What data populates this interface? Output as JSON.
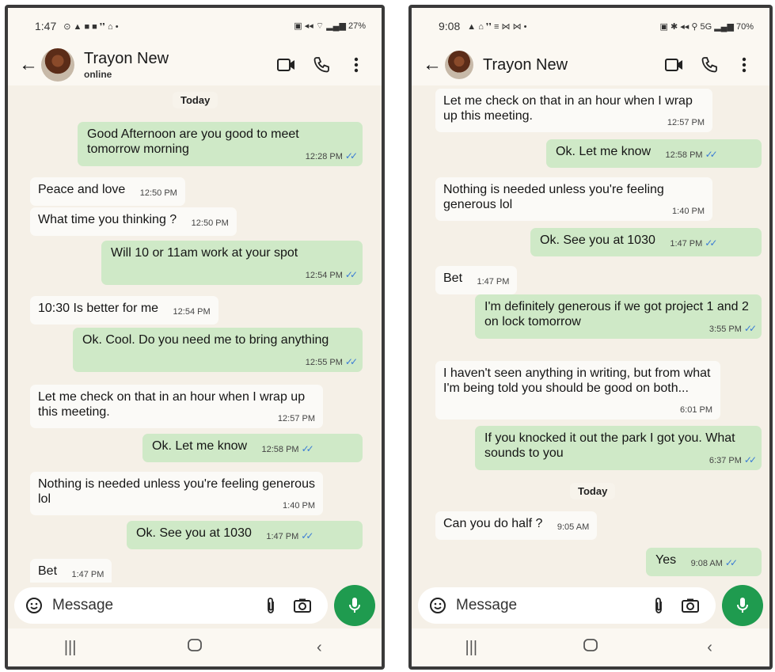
{
  "left": {
    "status_bar": {
      "time": "1:47",
      "left_icons": "⊙ ▲ ■ ■ ❜❜ ⌂ •",
      "right_icons": "▣ ◂◂ ⌔ ▂▄▆ 27%"
    },
    "header": {
      "contact_name": "Trayon New",
      "contact_status": "online"
    },
    "day_label": "Today",
    "messages": [
      {
        "text": "Good Afternoon are you good to meet tomorrow morning",
        "time": "12:28 PM",
        "dir": "out"
      },
      {
        "text": "Peace and love",
        "time": "12:50 PM",
        "dir": "in"
      },
      {
        "text": "What time you thinking ?",
        "time": "12:50 PM",
        "dir": "in"
      },
      {
        "text": "Will 10 or 11am work at your spot",
        "time": "12:54 PM",
        "dir": "out"
      },
      {
        "text": "10:30 Is better for me",
        "time": "12:54 PM",
        "dir": "in"
      },
      {
        "text": "Ok. Cool.  Do you need me to bring anything",
        "time": "12:55 PM",
        "dir": "out"
      },
      {
        "text": "Let me check on that in an hour when I wrap up this meeting.",
        "time": "12:57 PM",
        "dir": "in"
      },
      {
        "text": "Ok. Let me know",
        "time": "12:58 PM",
        "dir": "out"
      },
      {
        "text": "Nothing is needed unless you're feeling generous lol",
        "time": "1:40 PM",
        "dir": "in"
      },
      {
        "text": "Ok. See you at 1030",
        "time": "1:47 PM",
        "dir": "out"
      },
      {
        "text": "Bet",
        "time": "1:47 PM",
        "dir": "in"
      }
    ],
    "composer": {
      "placeholder": "Message"
    }
  },
  "right": {
    "status_bar": {
      "time": "9:08",
      "left_icons": "▲ ⌂ ❜❜ ≡ ⋈ ⋈ •",
      "right_icons": "▣ ✱ ◂◂ ⚲ 5G ▂▄▆ 70%"
    },
    "header": {
      "contact_name": "Trayon New"
    },
    "day_label": "Today",
    "messages": [
      {
        "text": "Let me check on that in an hour when I wrap up this meeting.",
        "time": "12:57 PM",
        "dir": "in"
      },
      {
        "text": "Ok. Let me know",
        "time": "12:58 PM",
        "dir": "out"
      },
      {
        "text": "Nothing is needed unless you're feeling generous lol",
        "time": "1:40 PM",
        "dir": "in"
      },
      {
        "text": "Ok. See you at 1030",
        "time": "1:47 PM",
        "dir": "out"
      },
      {
        "text": "Bet",
        "time": "1:47 PM",
        "dir": "in"
      },
      {
        "text": "I'm definitely generous if we got project 1 and 2 on lock tomorrow",
        "time": "3:55 PM",
        "dir": "out"
      },
      {
        "text": "I haven't seen anything in writing, but from what I'm being told you should be good on both...",
        "time": "6:01 PM",
        "dir": "in"
      },
      {
        "text": "If you knocked it out the park I got you. What sounds to you",
        "time": "6:37 PM",
        "dir": "out"
      },
      {
        "text": "Can you do half ?",
        "time": "9:05 AM",
        "dir": "in"
      },
      {
        "text": "Yes",
        "time": "9:08 AM",
        "dir": "out"
      }
    ],
    "composer": {
      "placeholder": "Message"
    }
  },
  "colors": {
    "outgoing_bubble": "#cfe9c7",
    "incoming_bubble": "#fbfaf7",
    "chat_background": "#f5f0e7",
    "mic_button": "#1f9b4f",
    "read_ticks": "#3a7bd5"
  },
  "icons": {
    "back": "back-arrow-icon",
    "video": "video-call-icon",
    "phone": "phone-call-icon",
    "menu": "more-vert-icon",
    "emoji": "emoji-icon",
    "attach": "paperclip-icon",
    "camera": "camera-icon",
    "mic": "microphone-icon",
    "nav_recents": "recents-icon",
    "nav_home": "home-icon",
    "nav_back": "nav-back-icon"
  }
}
